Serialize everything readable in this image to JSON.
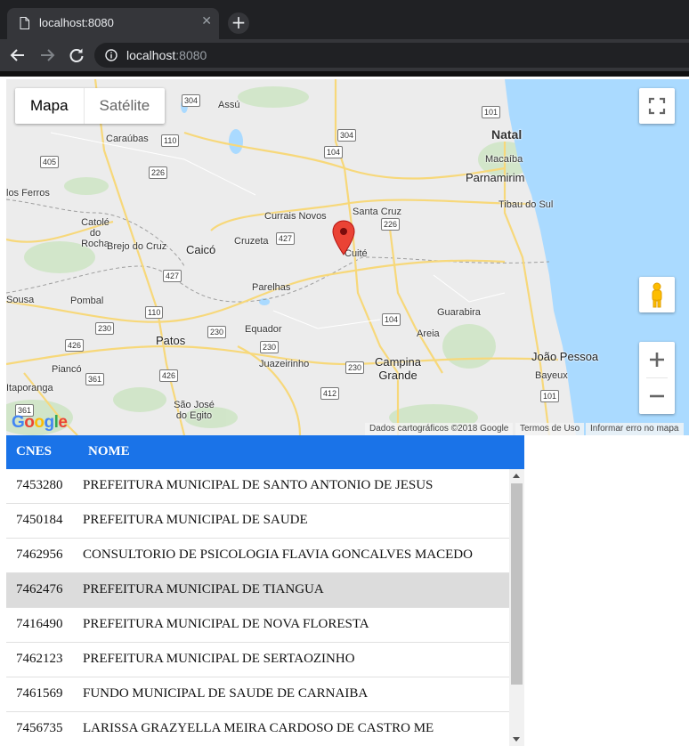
{
  "browser": {
    "tab_title": "localhost:8080",
    "url_host": "localhost",
    "url_port": ":8080"
  },
  "map": {
    "type_controls": {
      "map": "Mapa",
      "satellite": "Satélite"
    },
    "attribution": {
      "data": "Dados cartográficos ©2018 Google",
      "terms": "Termos de Uso",
      "report": "Informar erro no mapa"
    },
    "logo_text": "Google",
    "places": {
      "natal": "Natal",
      "macaiba": "Macaíba",
      "parnamirim": "Parnamirim",
      "tibau": "Tibau do Sul",
      "santa_cruz": "Santa Cruz",
      "cuite": "Cuité",
      "currais_novos": "Currais Novos",
      "caico": "Caicó",
      "cruzeta": "Cruzeta",
      "catole": "Catolé do Rocha",
      "brejo": "Brejo do Cruz",
      "caraubas": "Caraúbas",
      "assu": "Assú",
      "pau_ferros": "los Ferros",
      "sousa": "Sousa",
      "pombal": "Pombal",
      "parelhas": "Parelhas",
      "patos": "Patos",
      "equador": "Equador",
      "juazeirinho": "Juazeirinho",
      "campina": "Campina Grande",
      "guarabira": "Guarabira",
      "areia": "Areia",
      "joao_pessoa": "João Pessoa",
      "bayeux": "Bayeux",
      "pianco": "Piancó",
      "itaporanga": "Itaporanga",
      "sao_jose": "São José do Egito"
    },
    "roads": [
      "304",
      "101",
      "304",
      "104",
      "110",
      "405",
      "226",
      "427",
      "226",
      "427",
      "110",
      "104",
      "230",
      "230",
      "426",
      "230",
      "361",
      "230",
      "412",
      "426",
      "361",
      "101"
    ]
  },
  "table": {
    "columns": [
      "CNES",
      "NOME"
    ],
    "rows": [
      {
        "cnes": "7453280",
        "nome": "PREFEITURA MUNICIPAL DE SANTO ANTONIO DE JESUS"
      },
      {
        "cnes": "7450184",
        "nome": "PREFEITURA MUNICIPAL DE SAUDE"
      },
      {
        "cnes": "7462956",
        "nome": "CONSULTORIO DE PSICOLOGIA FLAVIA GONCALVES MACEDO"
      },
      {
        "cnes": "7462476",
        "nome": "PREFEITURA MUNICIPAL DE TIANGUA"
      },
      {
        "cnes": "7416490",
        "nome": "PREFEITURA MUNICIPAL DE NOVA FLORESTA"
      },
      {
        "cnes": "7462123",
        "nome": "PREFEITURA MUNICIPAL DE SERTAOZINHO"
      },
      {
        "cnes": "7461569",
        "nome": "FUNDO MUNICIPAL DE SAUDE DE CARNAIBA"
      },
      {
        "cnes": "7456735",
        "nome": "LARISSA GRAZYELLA MEIRA CARDOSO DE CASTRO ME"
      }
    ]
  }
}
